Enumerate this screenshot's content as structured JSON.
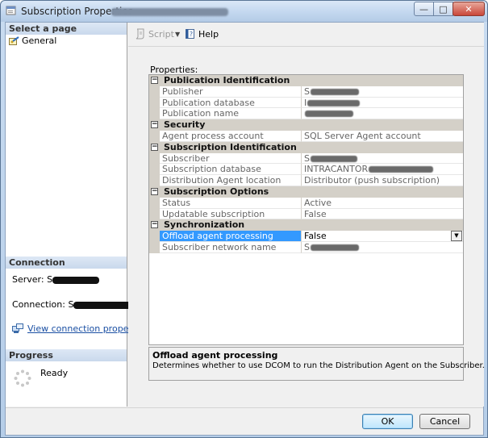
{
  "window": {
    "title": "Subscription Properties - ",
    "title_redacted": "SQLDBX...\\INTRACANTOR"
  },
  "left_panel": {
    "select_page_header": "Select a page",
    "pages": [
      {
        "label": "General"
      }
    ],
    "connection_header": "Connection",
    "server_label": "Server: S",
    "connection_label": "Connection: S",
    "view_connection_link": "View connection properties",
    "progress_header": "Progress",
    "progress_status": "Ready"
  },
  "toolbar": {
    "script_label": "Script",
    "help_label": "Help"
  },
  "properties_label": "Properties:",
  "categories": [
    {
      "name": "Publication Identification",
      "props": [
        {
          "name": "Publisher",
          "value": "S",
          "redacted": true
        },
        {
          "name": "Publication database",
          "value": "I",
          "redacted": true
        },
        {
          "name": "Publication name",
          "value": "",
          "redacted": true
        }
      ]
    },
    {
      "name": "Security",
      "props": [
        {
          "name": "Agent process account",
          "value": "SQL Server Agent account"
        }
      ]
    },
    {
      "name": "Subscription Identification",
      "props": [
        {
          "name": "Subscriber",
          "value": "S",
          "redacted": true
        },
        {
          "name": "Subscription database",
          "value": "INTRACANTOR",
          "redacted": true
        },
        {
          "name": "Distribution Agent location",
          "value": "Distributor (push subscription)"
        }
      ]
    },
    {
      "name": "Subscription Options",
      "props": [
        {
          "name": "Status",
          "value": "Active"
        },
        {
          "name": "Updatable subscription",
          "value": "False"
        }
      ]
    },
    {
      "name": "Synchronization",
      "props": [
        {
          "name": "Offload agent processing",
          "value": "False",
          "selected": true
        },
        {
          "name": "Subscriber network name",
          "value": "S",
          "redacted": true
        }
      ]
    }
  ],
  "description": {
    "title": "Offload agent processing",
    "text": "Determines whether to use DCOM to run the Distribution Agent on the Subscriber."
  },
  "buttons": {
    "ok": "OK",
    "cancel": "Cancel"
  }
}
